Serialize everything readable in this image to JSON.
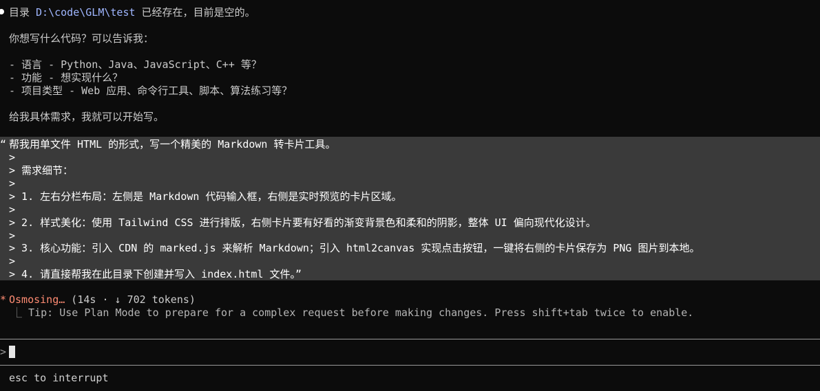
{
  "response": {
    "line1": {
      "prefix": "目录 ",
      "path": "D:\\code\\GLM\\test",
      "suffix": " 已经存在，目前是空的。"
    },
    "line2": "你想写什么代码？可以告诉我：",
    "bullets": [
      "- 语言 - Python、Java、JavaScript、C++ 等？",
      "- 功能 - 想实现什么？",
      "- 项目类型 - Web 应用、命令行工具、脚本、算法练习等？"
    ],
    "closing": "给我具体需求，我就可以开始写。"
  },
  "user_prompt": {
    "open_quote": "“",
    "lines": [
      "帮我用单文件 HTML 的形式，写一个精美的 Markdown 转卡片工具。",
      ">",
      "> 需求细节：",
      ">",
      "> 1. 左右分栏布局：左侧是 Markdown 代码输入框，右侧是实时预览的卡片区域。",
      ">",
      "> 2. 样式美化：使用 Tailwind CSS 进行排版，右侧卡片要有好看的渐变背景色和柔和的阴影，整体 UI 偏向现代化设计。",
      ">",
      "> 3. 核心功能：引入 CDN 的 marked.js 来解析 Markdown；引入 html2canvas 实现点击按钮，一键将右侧的卡片保存为 PNG 图片到本地。",
      ">",
      "> 4. 请直接帮我在此目录下创建并写入 index.html 文件。”"
    ]
  },
  "status": {
    "spinner_glyph": "*",
    "word": "Osmosing…",
    "detail": " (14s · ↓ 702 tokens)",
    "tip_prefix": "⎿",
    "tip": "Tip: Use Plan Mode to prepare for a complex request before making changes. Press shift+tab twice to enable."
  },
  "input": {
    "arrow": ">",
    "value": ""
  },
  "footer": {
    "hint": "esc to interrupt"
  },
  "colors": {
    "background": "#0c0c0c",
    "prompt_block": "#3a3a3a",
    "path": "#9fb6ff",
    "status_accent": "#ff8c73"
  }
}
